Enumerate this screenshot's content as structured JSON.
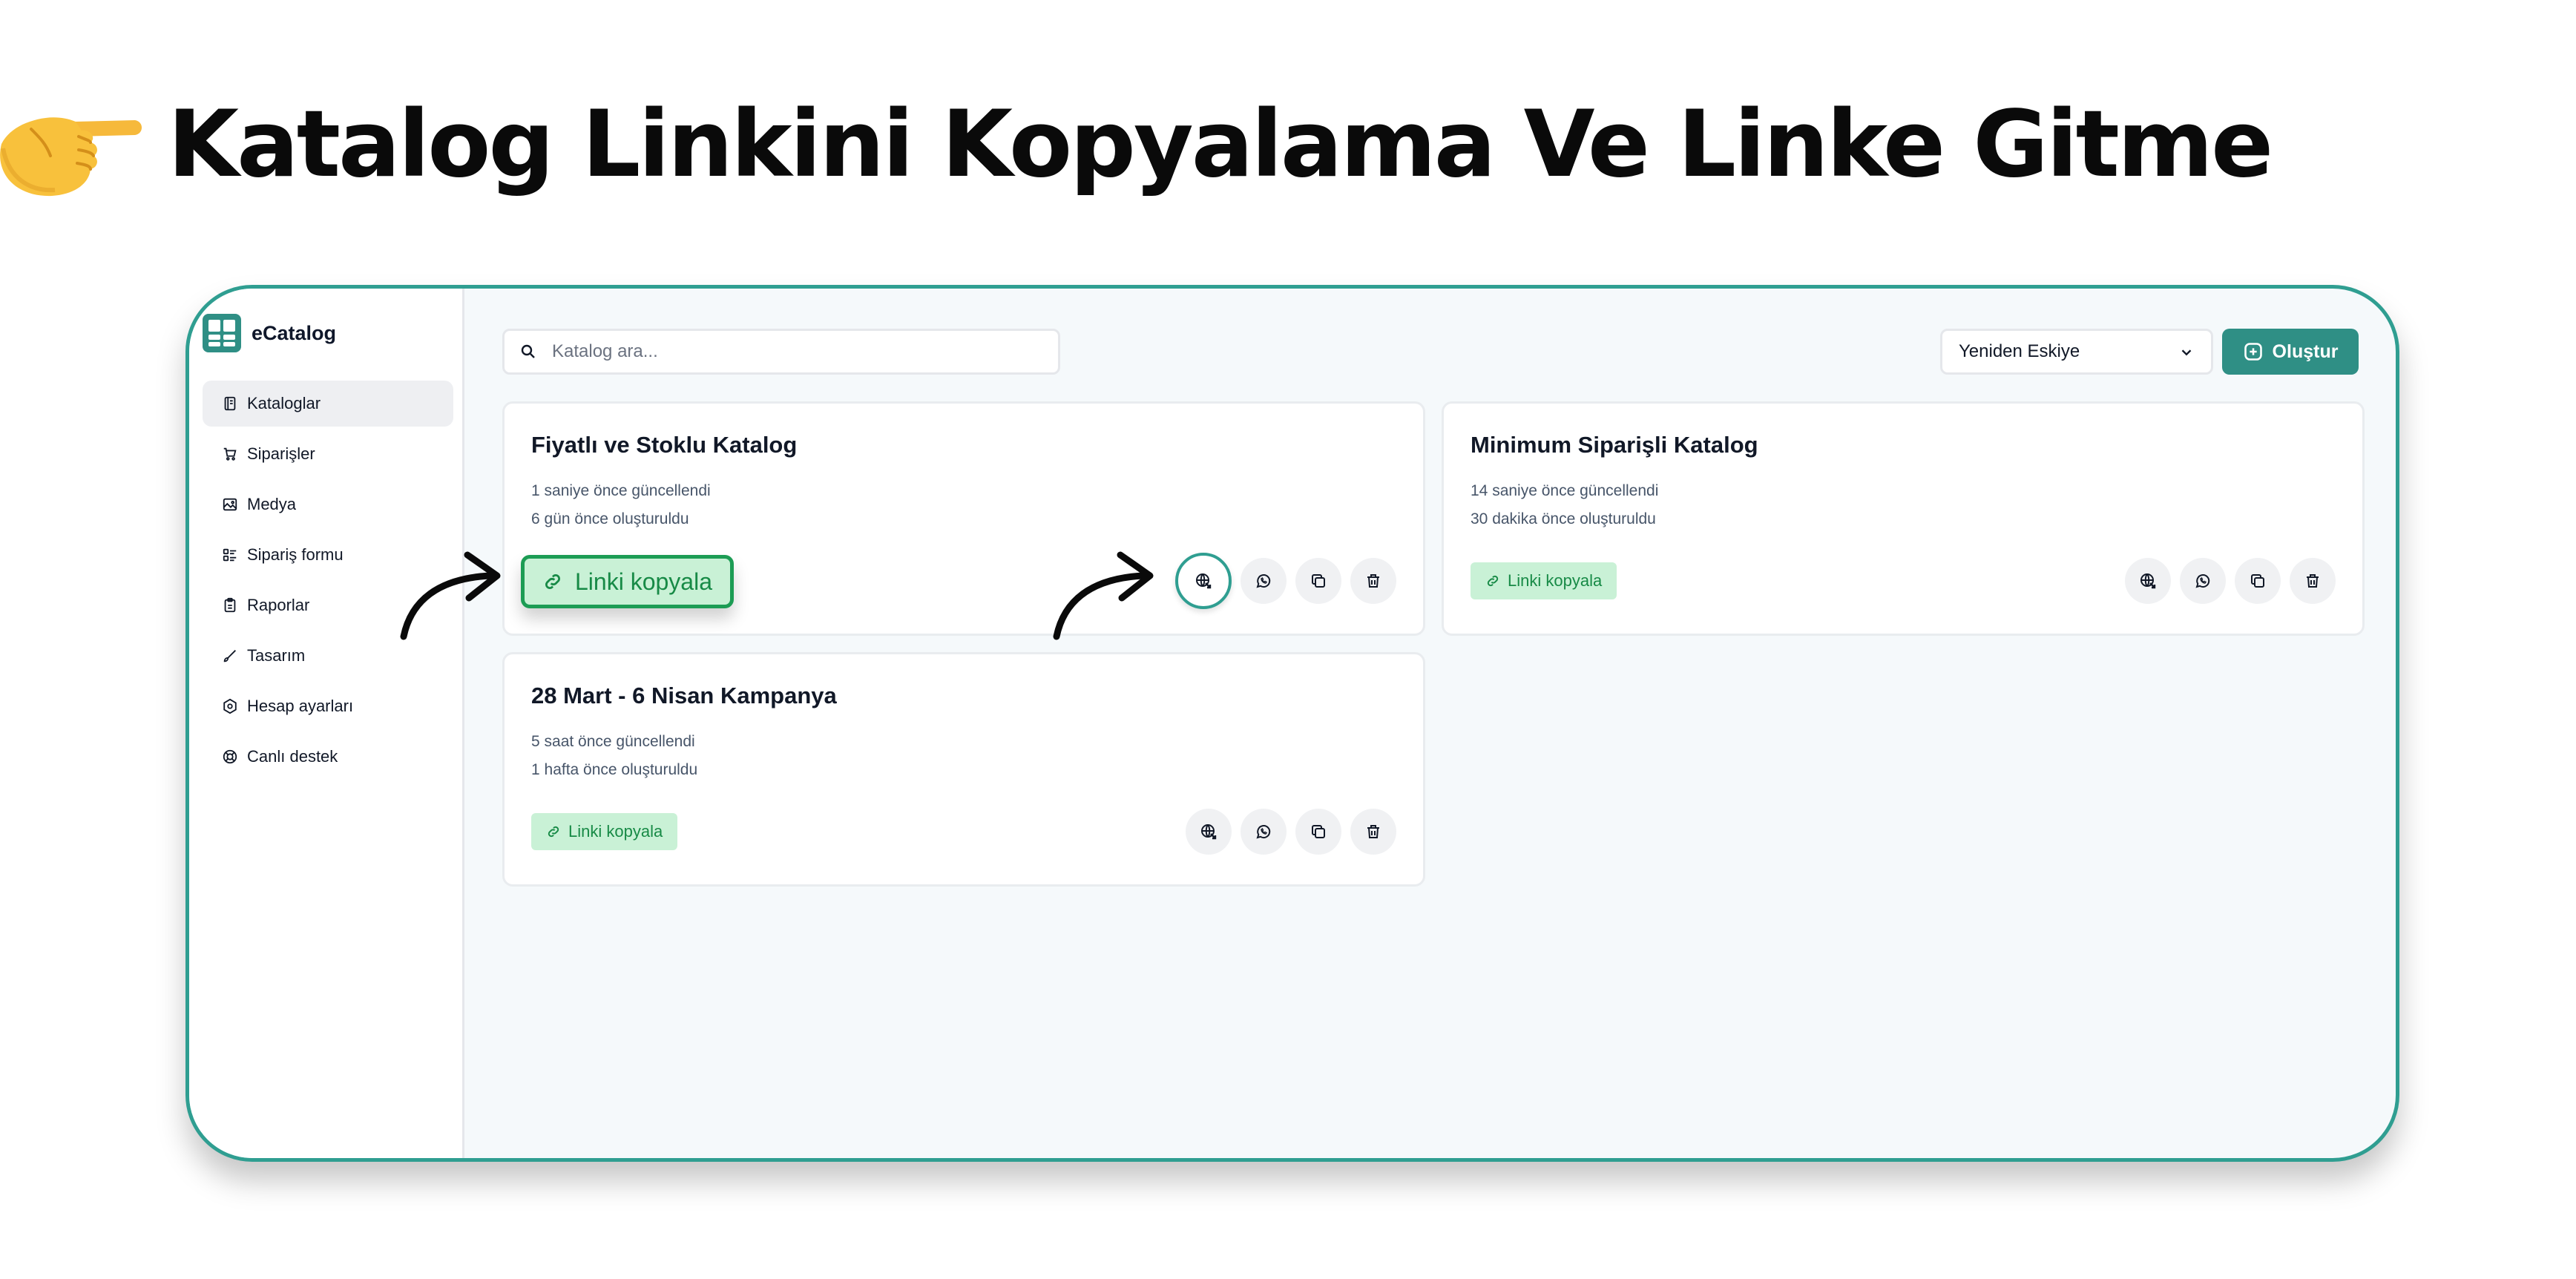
{
  "headline": {
    "text": "Katalog Linkini Kopyalama Ve Linke Gitme",
    "icon": "pointing-hand-emoji"
  },
  "app": {
    "brand": "eCatalog",
    "accent_color": "#2f8f85",
    "frame_color": "#2f9e91",
    "sidebar": {
      "items": [
        {
          "label": "Kataloglar",
          "icon": "book-icon",
          "active": true
        },
        {
          "label": "Siparişler",
          "icon": "cart-icon",
          "active": false
        },
        {
          "label": "Medya",
          "icon": "image-icon",
          "active": false
        },
        {
          "label": "Sipariş formu",
          "icon": "form-icon",
          "active": false
        },
        {
          "label": "Raporlar",
          "icon": "clipboard-icon",
          "active": false
        },
        {
          "label": "Tasarım",
          "icon": "brush-icon",
          "active": false
        },
        {
          "label": "Hesap ayarları",
          "icon": "settings-icon",
          "active": false
        },
        {
          "label": "Canlı destek",
          "icon": "lifebuoy-icon",
          "active": false
        }
      ]
    },
    "toolbar": {
      "search_placeholder": "Katalog ara...",
      "sort_value": "Yeniden Eskiye",
      "create_label": "Oluştur"
    },
    "catalogs": [
      {
        "title": "Fiyatlı ve Stoklu Katalog",
        "updated": "1 saniye önce güncellendi",
        "created": "6 gün önce oluşturuldu",
        "copy_label": "Linki kopyala"
      },
      {
        "title": "Minimum Siparişli Katalog",
        "updated": "14 saniye önce güncellendi",
        "created": "30 dakika önce oluşturuldu",
        "copy_label": "Linki kopyala"
      },
      {
        "title": "28 Mart - 6 Nisan Kampanya",
        "updated": "5 saat önce güncellendi",
        "created": "1 hafta önce oluşturuldu",
        "copy_label": "Linki kopyala"
      }
    ],
    "card_actions": [
      "globe-link-icon",
      "whatsapp-icon",
      "duplicate-icon",
      "trash-icon"
    ]
  }
}
